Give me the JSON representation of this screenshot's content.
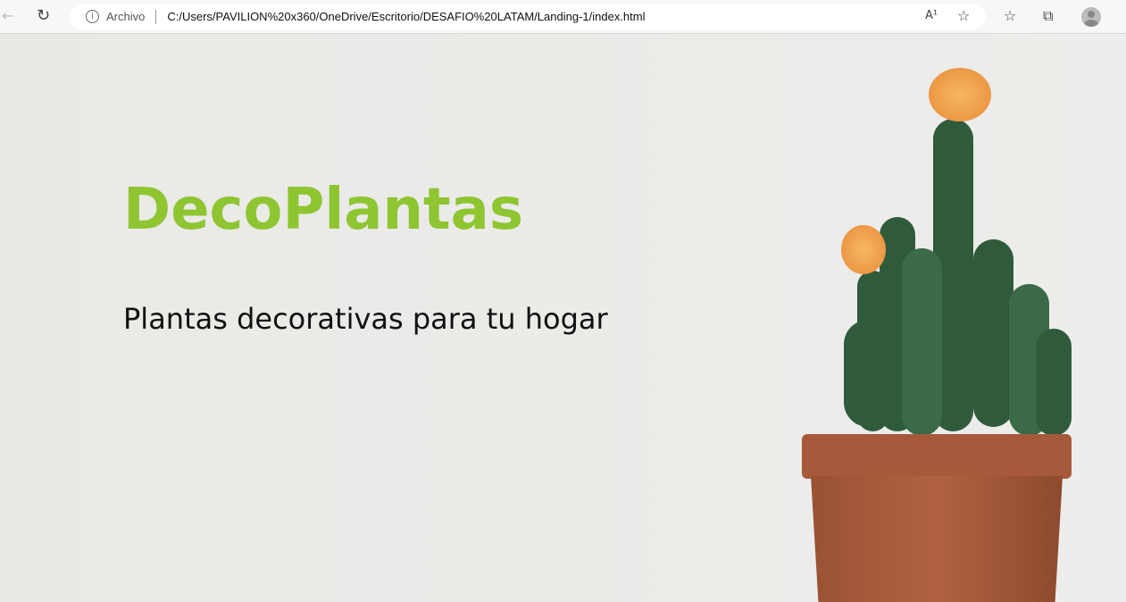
{
  "browser": {
    "address_prefix": "Archivo",
    "url": "C:/Users/PAVILION%20x360/OneDrive/Escritorio/DESAFIO%20LATAM/Landing-1/index.html",
    "read_aloud_icon": "A¹"
  },
  "hero": {
    "title": "DecoPlantas",
    "subtitle": "Plantas decorativas para tu hogar"
  },
  "colors": {
    "brand": "#8ec531"
  }
}
